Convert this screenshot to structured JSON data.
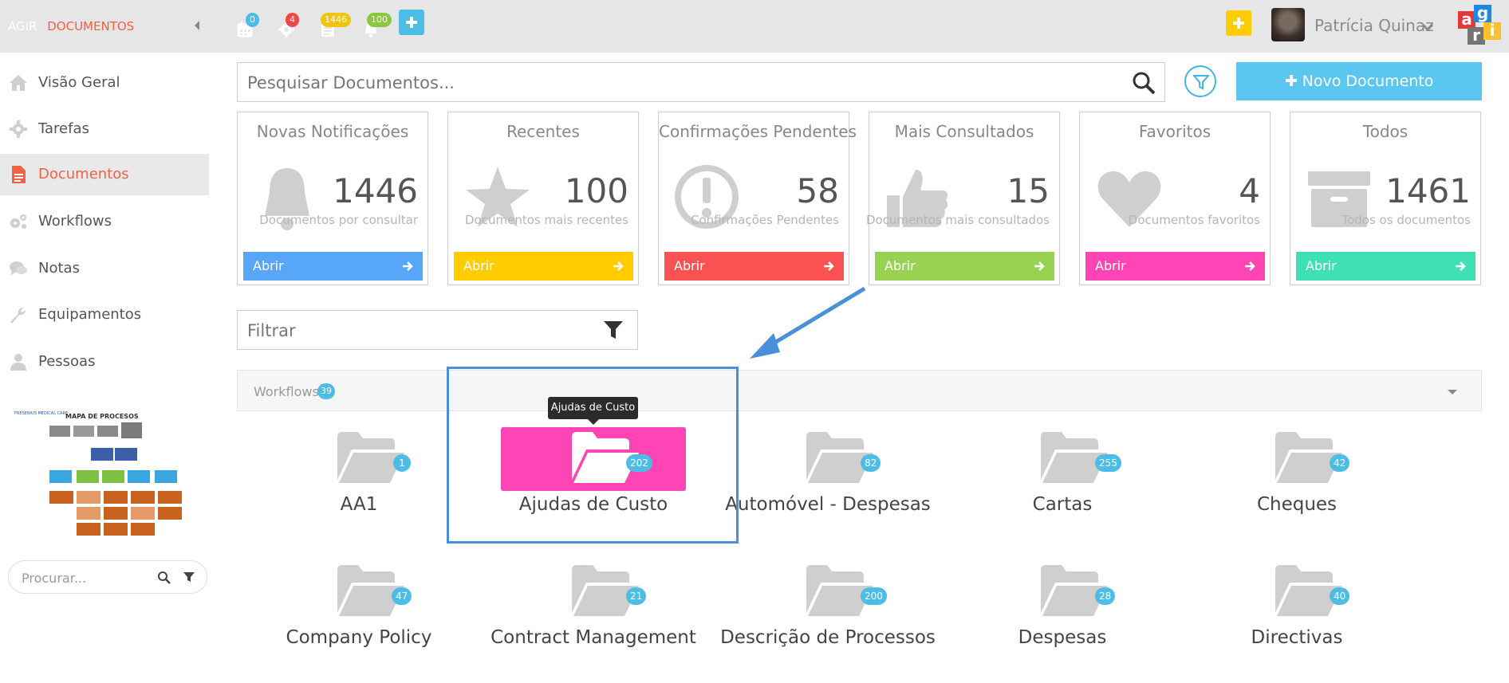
{
  "topbar": {
    "brand_primary": "AGIR",
    "brand_section": "DOCUMENTOS",
    "icons": [
      {
        "name": "calendar-icon",
        "badge": "0",
        "badge_color": "#4dbde6"
      },
      {
        "name": "gear-icon",
        "badge": "4",
        "badge_color": "#f04848"
      },
      {
        "name": "document-icon",
        "badge": "1446",
        "badge_color": "#f1c40f"
      },
      {
        "name": "bell-icon",
        "badge": "100",
        "badge_color": "#8dc63f"
      }
    ],
    "user_name": "Patrícia Quinaz",
    "logo_letters": [
      "a",
      "g",
      "r",
      "i"
    ]
  },
  "sidebar": {
    "items": [
      {
        "label": "Visão Geral",
        "icon": "home-icon"
      },
      {
        "label": "Tarefas",
        "icon": "gear-icon"
      },
      {
        "label": "Documentos",
        "icon": "document-icon",
        "active": true
      },
      {
        "label": "Workflows",
        "icon": "gears-icon"
      },
      {
        "label": "Notas",
        "icon": "comments-icon"
      },
      {
        "label": "Equipamentos",
        "icon": "wrench-icon"
      },
      {
        "label": "Pessoas",
        "icon": "user-icon"
      }
    ],
    "process_map": {
      "title": "MAPA DE PROCESOS",
      "brand": "FRESENIUS MEDICAL CARE"
    },
    "search_placeholder": "Procurar..."
  },
  "main": {
    "search_placeholder": "Pesquisar Documentos...",
    "new_document_label": "Novo Documento",
    "cards": [
      {
        "title": "Novas Notificações",
        "count": "1446",
        "subtitle": "Documentos por consultar",
        "button": "Abrir",
        "color": "#58a6f8",
        "icon": "bell-icon"
      },
      {
        "title": "Recentes",
        "count": "100",
        "subtitle": "Documentos mais recentes",
        "button": "Abrir",
        "color": "#ffcc00",
        "icon": "star-icon"
      },
      {
        "title": "Confirmações Pendentes",
        "count": "58",
        "subtitle": "Confirmações Pendentes",
        "button": "Abrir",
        "color": "#fa5252",
        "icon": "exclamation-circle-icon"
      },
      {
        "title": "Mais Consultados",
        "count": "15",
        "subtitle": "Documentos mais consultados",
        "button": "Abrir",
        "color": "#99d252",
        "icon": "thumbs-up-icon"
      },
      {
        "title": "Favoritos",
        "count": "4",
        "subtitle": "Documentos favoritos",
        "button": "Abrir",
        "color": "#ff44b5",
        "icon": "heart-icon"
      },
      {
        "title": "Todos",
        "count": "1461",
        "subtitle": "Todos os documentos",
        "button": "Abrir",
        "color": "#3ee0b4",
        "icon": "archive-icon"
      }
    ],
    "filter_placeholder": "Filtrar",
    "workflows": {
      "label": "Workflows",
      "count": "39",
      "tooltip": "Ajudas de Custo",
      "folders": [
        {
          "label": "AA1",
          "count": "1"
        },
        {
          "label": "Ajudas de Custo",
          "count": "202",
          "highlighted": true
        },
        {
          "label": "Automóvel - Despesas",
          "count": "82"
        },
        {
          "label": "Cartas",
          "count": "255"
        },
        {
          "label": "Cheques",
          "count": "42"
        },
        {
          "label": "Company Policy",
          "count": "47"
        },
        {
          "label": "Contract Management",
          "count": "21"
        },
        {
          "label": "Descrição de Processos",
          "count": "200"
        },
        {
          "label": "Despesas",
          "count": "28"
        },
        {
          "label": "Directivas",
          "count": "40"
        }
      ]
    }
  },
  "colors": {
    "accent": "#f16146",
    "info": "#4dbde6",
    "new_doc": "#5bc6f0",
    "callout": "#4a8fdc"
  }
}
